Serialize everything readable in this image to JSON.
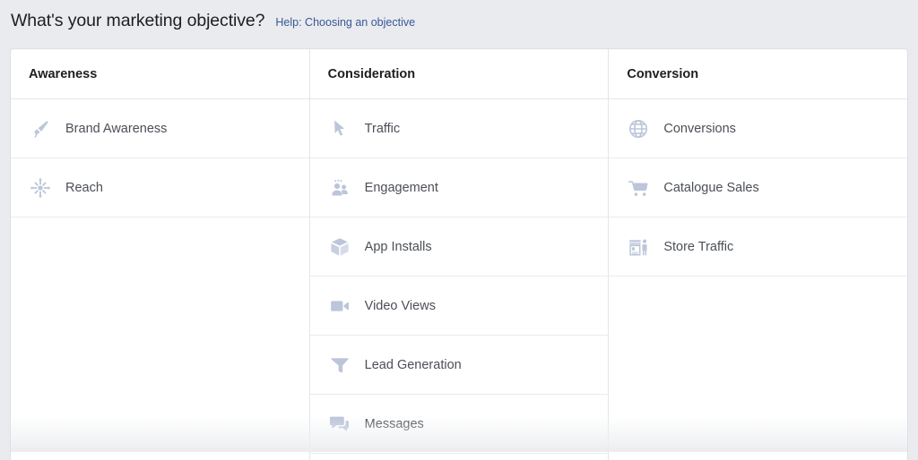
{
  "header": {
    "title": "What's your marketing objective?",
    "help_link": "Help: Choosing an objective"
  },
  "theme": {
    "page_background": "#e9ebee",
    "card_background": "#ffffff",
    "border_color": "#dddfe2",
    "row_divider": "#e9ebee",
    "icon_color": "#bcc5da",
    "label_color": "#4b4f56",
    "heading_color": "#1c1e21",
    "link_color": "#385898"
  },
  "columns": [
    {
      "id": "awareness",
      "header": "Awareness",
      "items": [
        {
          "label": "Brand Awareness",
          "icon": "megaphone-icon"
        },
        {
          "label": "Reach",
          "icon": "reach-starburst-icon"
        }
      ]
    },
    {
      "id": "consideration",
      "header": "Consideration",
      "items": [
        {
          "label": "Traffic",
          "icon": "cursor-arrow-icon"
        },
        {
          "label": "Engagement",
          "icon": "people-group-icon"
        },
        {
          "label": "App Installs",
          "icon": "cube-box-icon"
        },
        {
          "label": "Video Views",
          "icon": "video-camera-icon"
        },
        {
          "label": "Lead Generation",
          "icon": "funnel-icon"
        },
        {
          "label": "Messages",
          "icon": "speech-bubbles-icon"
        }
      ]
    },
    {
      "id": "conversion",
      "header": "Conversion",
      "items": [
        {
          "label": "Conversions",
          "icon": "globe-icon"
        },
        {
          "label": "Catalogue Sales",
          "icon": "shopping-cart-icon"
        },
        {
          "label": "Store Traffic",
          "icon": "storefront-icon"
        }
      ]
    }
  ]
}
